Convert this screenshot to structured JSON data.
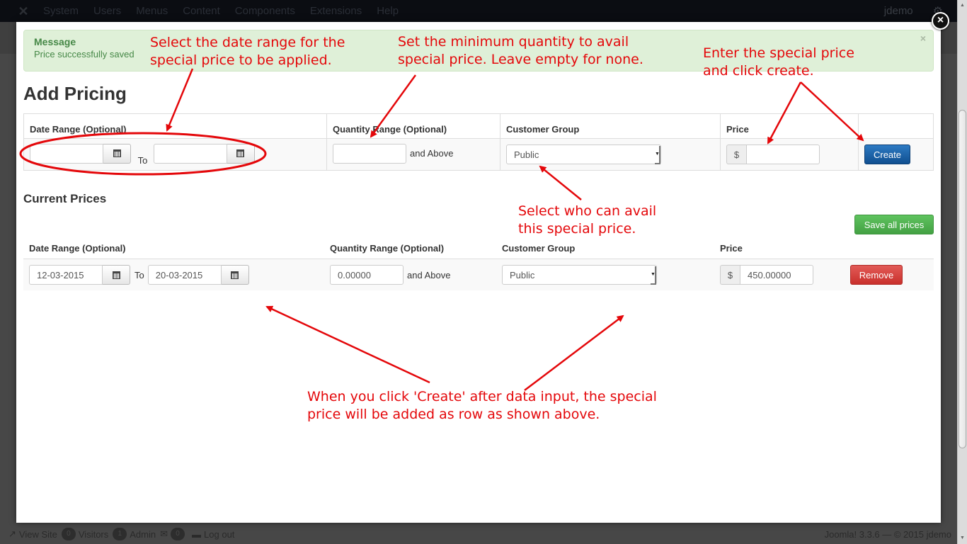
{
  "topnav": {
    "menu": [
      "System",
      "Users",
      "Menus",
      "Content",
      "Components",
      "Extensions",
      "Help"
    ],
    "user": "jdemo",
    "gear_icon": "gear-icon"
  },
  "statusbar": {
    "view_site": "View Site",
    "visitors_count": "0",
    "visitors_label": "Visitors",
    "admin_count": "1",
    "admin_label": "Admin",
    "messages_count": "0",
    "logout": "Log out",
    "copyright": "Joomla! 3.3.6  —  © 2015 jdemo"
  },
  "modal": {
    "close_icon": "×",
    "alert": {
      "heading": "Message",
      "text": "Price successfully saved",
      "close": "×"
    },
    "add_pricing": {
      "title": "Add Pricing",
      "headers": [
        "Date Range (Optional)",
        "Quantity Range (Optional)",
        "Customer Group",
        "Price",
        ""
      ],
      "from_date": "",
      "to_label": "To",
      "to_date": "",
      "quantity": "",
      "and_above": "and Above",
      "customer_group": "Public",
      "currency": "$",
      "price": "",
      "create_label": "Create"
    },
    "current_prices": {
      "title": "Current Prices",
      "save_all_label": "Save all prices",
      "headers": [
        "Date Range (Optional)",
        "Quantity Range (Optional)",
        "Customer Group",
        "Price"
      ],
      "rows": [
        {
          "from_date": "12-03-2015",
          "to_label": "To",
          "to_date": "20-03-2015",
          "quantity": "0.00000",
          "and_above": "and Above",
          "customer_group": "Public",
          "currency": "$",
          "price": "450.00000",
          "remove_label": "Remove"
        }
      ]
    }
  },
  "annotations": {
    "date_range": "Select the date range for the\nspecial price to be applied.",
    "quantity": "Set the minimum quantity to avail\nspecial price. Leave empty for none.",
    "price": "Enter the special price\nand click create.",
    "group": "Select who can avail\nthis special price.",
    "result": "When you click 'Create' after data input, the special\nprice will be added as row as shown above."
  },
  "colors": {
    "annotation": "#e4070a",
    "create": "#1a61a8",
    "save": "#51b351",
    "remove": "#d9534f",
    "alert_bg": "#dff0d8"
  }
}
